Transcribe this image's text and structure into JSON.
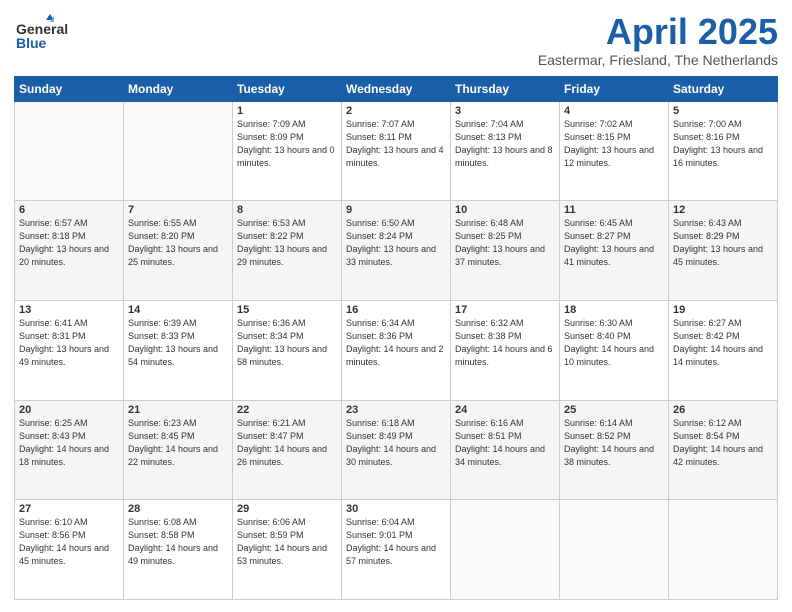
{
  "header": {
    "logo_general": "General",
    "logo_blue": "Blue",
    "title": "April 2025",
    "location": "Eastermar, Friesland, The Netherlands"
  },
  "days_of_week": [
    "Sunday",
    "Monday",
    "Tuesday",
    "Wednesday",
    "Thursday",
    "Friday",
    "Saturday"
  ],
  "weeks": [
    [
      {
        "num": "",
        "info": ""
      },
      {
        "num": "",
        "info": ""
      },
      {
        "num": "1",
        "info": "Sunrise: 7:09 AM\nSunset: 8:09 PM\nDaylight: 13 hours\nand 0 minutes."
      },
      {
        "num": "2",
        "info": "Sunrise: 7:07 AM\nSunset: 8:11 PM\nDaylight: 13 hours\nand 4 minutes."
      },
      {
        "num": "3",
        "info": "Sunrise: 7:04 AM\nSunset: 8:13 PM\nDaylight: 13 hours\nand 8 minutes."
      },
      {
        "num": "4",
        "info": "Sunrise: 7:02 AM\nSunset: 8:15 PM\nDaylight: 13 hours\nand 12 minutes."
      },
      {
        "num": "5",
        "info": "Sunrise: 7:00 AM\nSunset: 8:16 PM\nDaylight: 13 hours\nand 16 minutes."
      }
    ],
    [
      {
        "num": "6",
        "info": "Sunrise: 6:57 AM\nSunset: 8:18 PM\nDaylight: 13 hours\nand 20 minutes."
      },
      {
        "num": "7",
        "info": "Sunrise: 6:55 AM\nSunset: 8:20 PM\nDaylight: 13 hours\nand 25 minutes."
      },
      {
        "num": "8",
        "info": "Sunrise: 6:53 AM\nSunset: 8:22 PM\nDaylight: 13 hours\nand 29 minutes."
      },
      {
        "num": "9",
        "info": "Sunrise: 6:50 AM\nSunset: 8:24 PM\nDaylight: 13 hours\nand 33 minutes."
      },
      {
        "num": "10",
        "info": "Sunrise: 6:48 AM\nSunset: 8:25 PM\nDaylight: 13 hours\nand 37 minutes."
      },
      {
        "num": "11",
        "info": "Sunrise: 6:45 AM\nSunset: 8:27 PM\nDaylight: 13 hours\nand 41 minutes."
      },
      {
        "num": "12",
        "info": "Sunrise: 6:43 AM\nSunset: 8:29 PM\nDaylight: 13 hours\nand 45 minutes."
      }
    ],
    [
      {
        "num": "13",
        "info": "Sunrise: 6:41 AM\nSunset: 8:31 PM\nDaylight: 13 hours\nand 49 minutes."
      },
      {
        "num": "14",
        "info": "Sunrise: 6:39 AM\nSunset: 8:33 PM\nDaylight: 13 hours\nand 54 minutes."
      },
      {
        "num": "15",
        "info": "Sunrise: 6:36 AM\nSunset: 8:34 PM\nDaylight: 13 hours\nand 58 minutes."
      },
      {
        "num": "16",
        "info": "Sunrise: 6:34 AM\nSunset: 8:36 PM\nDaylight: 14 hours\nand 2 minutes."
      },
      {
        "num": "17",
        "info": "Sunrise: 6:32 AM\nSunset: 8:38 PM\nDaylight: 14 hours\nand 6 minutes."
      },
      {
        "num": "18",
        "info": "Sunrise: 6:30 AM\nSunset: 8:40 PM\nDaylight: 14 hours\nand 10 minutes."
      },
      {
        "num": "19",
        "info": "Sunrise: 6:27 AM\nSunset: 8:42 PM\nDaylight: 14 hours\nand 14 minutes."
      }
    ],
    [
      {
        "num": "20",
        "info": "Sunrise: 6:25 AM\nSunset: 8:43 PM\nDaylight: 14 hours\nand 18 minutes."
      },
      {
        "num": "21",
        "info": "Sunrise: 6:23 AM\nSunset: 8:45 PM\nDaylight: 14 hours\nand 22 minutes."
      },
      {
        "num": "22",
        "info": "Sunrise: 6:21 AM\nSunset: 8:47 PM\nDaylight: 14 hours\nand 26 minutes."
      },
      {
        "num": "23",
        "info": "Sunrise: 6:18 AM\nSunset: 8:49 PM\nDaylight: 14 hours\nand 30 minutes."
      },
      {
        "num": "24",
        "info": "Sunrise: 6:16 AM\nSunset: 8:51 PM\nDaylight: 14 hours\nand 34 minutes."
      },
      {
        "num": "25",
        "info": "Sunrise: 6:14 AM\nSunset: 8:52 PM\nDaylight: 14 hours\nand 38 minutes."
      },
      {
        "num": "26",
        "info": "Sunrise: 6:12 AM\nSunset: 8:54 PM\nDaylight: 14 hours\nand 42 minutes."
      }
    ],
    [
      {
        "num": "27",
        "info": "Sunrise: 6:10 AM\nSunset: 8:56 PM\nDaylight: 14 hours\nand 45 minutes."
      },
      {
        "num": "28",
        "info": "Sunrise: 6:08 AM\nSunset: 8:58 PM\nDaylight: 14 hours\nand 49 minutes."
      },
      {
        "num": "29",
        "info": "Sunrise: 6:06 AM\nSunset: 8:59 PM\nDaylight: 14 hours\nand 53 minutes."
      },
      {
        "num": "30",
        "info": "Sunrise: 6:04 AM\nSunset: 9:01 PM\nDaylight: 14 hours\nand 57 minutes."
      },
      {
        "num": "",
        "info": ""
      },
      {
        "num": "",
        "info": ""
      },
      {
        "num": "",
        "info": ""
      }
    ]
  ]
}
